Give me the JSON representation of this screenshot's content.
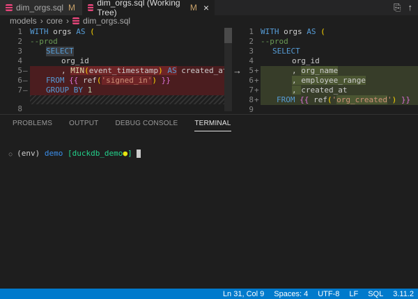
{
  "tabs": [
    {
      "label": "dim_orgs.sql",
      "badge": "M"
    },
    {
      "label": "dim_orgs.sql (Working Tree)",
      "badge": "M",
      "close": "×"
    }
  ],
  "breadcrumb": [
    "models",
    "core",
    "dim_orgs.sql"
  ],
  "left": {
    "nums": [
      "1",
      "2",
      "3",
      "4",
      "5",
      "6",
      "7",
      "8"
    ],
    "markers": [
      "",
      "",
      "",
      "",
      "—",
      "—",
      "—",
      ""
    ]
  },
  "right": {
    "nums": [
      "1",
      "2",
      "3",
      "4",
      "5",
      "6",
      "7",
      "8",
      "9"
    ],
    "markers": [
      "",
      "",
      "",
      "",
      "+",
      "+",
      "+",
      "+",
      ""
    ]
  },
  "code": {
    "with": "WITH",
    "orgs": " orgs ",
    "as": "AS",
    "paren": "(",
    "prod": "--prod",
    "select": "SELECT",
    "org_id": "org_id",
    "comma": ", ",
    "min": "MIN",
    "ets": "event_timestamp",
    "created": " created_at",
    "from": "FROM",
    "ref": " ref",
    "signed": "'signed_in'",
    "group": "GROUP BY",
    "one": "1",
    "org_name": "org_name",
    "emp": "employee_range",
    "created2": "created_at",
    "org_created": "org_created",
    "q": "'"
  },
  "panel": {
    "tabs": [
      "PROBLEMS",
      "OUTPUT",
      "DEBUG CONSOLE",
      "TERMINAL"
    ]
  },
  "terminal": {
    "env": "(env)",
    "user": "demo",
    "branch": "[duckdb_demo",
    "close": "]"
  },
  "status": [
    "Ln 31, Col 9",
    "Spaces: 4",
    "UTF-8",
    "LF",
    "SQL",
    "3.11.2"
  ]
}
